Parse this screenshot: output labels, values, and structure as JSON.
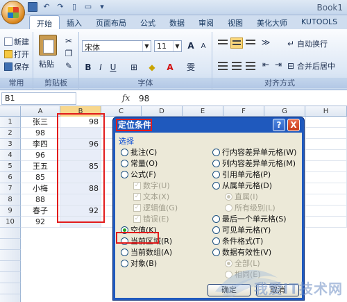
{
  "window": {
    "title": "Book1"
  },
  "tabs": [
    "开始",
    "插入",
    "页面布局",
    "公式",
    "数据",
    "审阅",
    "视图",
    "美化大师",
    "KUTOOLS"
  ],
  "ribbon": {
    "common": {
      "new": "新建",
      "open": "打开",
      "save": "保存",
      "label": "常用"
    },
    "clipboard": {
      "paste": "粘贴",
      "label": "剪贴板"
    },
    "font": {
      "font_name": "宋体",
      "font_size": "11",
      "label": "字体",
      "grow": "A",
      "shrink": "A",
      "bold": "B",
      "italic": "I",
      "underline": "U",
      "phonetic": "雯"
    },
    "alignment": {
      "wrap": "自动换行",
      "merge": "合并后居中",
      "label": "对齐方式"
    }
  },
  "formula_bar": {
    "name_box": "B1",
    "fx": "fx",
    "value": "98"
  },
  "sheet": {
    "columns": [
      "A",
      "B",
      "C",
      "D",
      "E",
      "F",
      "G",
      "H"
    ],
    "rows": [
      "1",
      "2",
      "3",
      "4",
      "5",
      "6",
      "7",
      "8",
      "9",
      "10"
    ],
    "colA": [
      "张三",
      "98",
      "李四",
      "96",
      "王五",
      "85",
      "小梅",
      "88",
      "春子",
      "92"
    ],
    "colB": [
      "98",
      "",
      "96",
      "",
      "85",
      "",
      "88",
      "",
      "92",
      ""
    ]
  },
  "dialog": {
    "title": "定位条件",
    "help": "?",
    "close": "X",
    "group": "选择",
    "left_options": [
      {
        "label": "批注(C)",
        "type": "radio",
        "on": false,
        "disabled": false
      },
      {
        "label": "常量(O)",
        "type": "radio",
        "on": false,
        "disabled": false
      },
      {
        "label": "公式(F)",
        "type": "radio",
        "on": false,
        "disabled": false
      },
      {
        "label": "数字(U)",
        "type": "check",
        "on": true,
        "disabled": true
      },
      {
        "label": "文本(X)",
        "type": "check",
        "on": true,
        "disabled": true
      },
      {
        "label": "逻辑值(G)",
        "type": "check",
        "on": true,
        "disabled": true
      },
      {
        "label": "错误(E)",
        "type": "check",
        "on": true,
        "disabled": true
      },
      {
        "label": "空值(K)",
        "type": "radio",
        "on": true,
        "disabled": false
      },
      {
        "label": "当前区域(R)",
        "type": "radio",
        "on": false,
        "disabled": false
      },
      {
        "label": "当前数组(A)",
        "type": "radio",
        "on": false,
        "disabled": false
      },
      {
        "label": "对象(B)",
        "type": "radio",
        "on": false,
        "disabled": false
      }
    ],
    "right_options": [
      {
        "label": "行内容差异单元格(W)",
        "type": "radio",
        "on": false,
        "disabled": false
      },
      {
        "label": "列内容差异单元格(M)",
        "type": "radio",
        "on": false,
        "disabled": false
      },
      {
        "label": "引用单元格(P)",
        "type": "radio",
        "on": false,
        "disabled": false
      },
      {
        "label": "从属单元格(D)",
        "type": "radio",
        "on": false,
        "disabled": false
      },
      {
        "label": "直属(I)",
        "type": "radio",
        "on": true,
        "disabled": true
      },
      {
        "label": "所有级别(L)",
        "type": "radio",
        "on": false,
        "disabled": true
      },
      {
        "label": "最后一个单元格(S)",
        "type": "radio",
        "on": false,
        "disabled": false
      },
      {
        "label": "可见单元格(Y)",
        "type": "radio",
        "on": false,
        "disabled": false
      },
      {
        "label": "条件格式(T)",
        "type": "radio",
        "on": false,
        "disabled": false
      },
      {
        "label": "数据有效性(V)",
        "type": "radio",
        "on": false,
        "disabled": false
      },
      {
        "label": "全部(L)",
        "type": "radio",
        "on": true,
        "disabled": true
      },
      {
        "label": "相同(E)",
        "type": "radio",
        "on": false,
        "disabled": true
      }
    ],
    "ok": "确定",
    "cancel": "取消"
  },
  "watermark": "我爱IT技术网"
}
